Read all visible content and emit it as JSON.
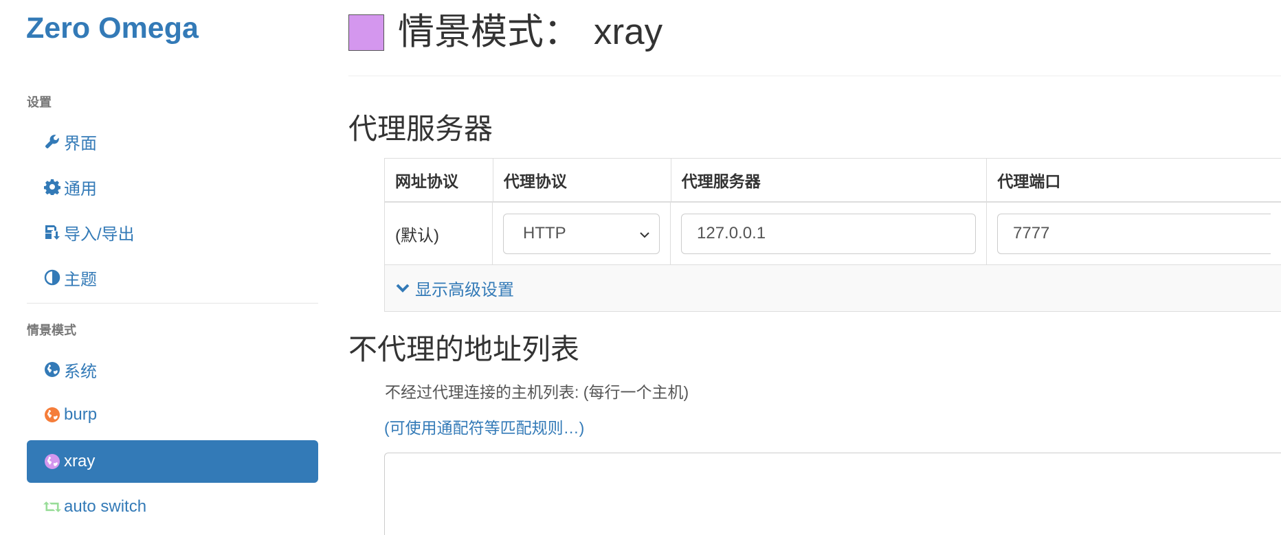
{
  "brand": "Zero Omega",
  "sidebar": {
    "settings_header": "设置",
    "settings_items": [
      {
        "label": "界面",
        "icon": "wrench-icon"
      },
      {
        "label": "通用",
        "icon": "gear-icon"
      },
      {
        "label": "导入/导出",
        "icon": "floppy-import-icon"
      },
      {
        "label": "主题",
        "icon": "contrast-icon"
      }
    ],
    "profiles_header": "情景模式",
    "profile_items": [
      {
        "label": "系统",
        "icon": "globe-icon",
        "color": "#337ab7"
      },
      {
        "label": "burp",
        "icon": "globe-icon",
        "color": "#f57d3a"
      },
      {
        "label": "xray",
        "icon": "globe-icon",
        "color": "#d497ee",
        "active": true
      },
      {
        "label": "auto switch",
        "icon": "switch-icon",
        "color": "#99dd99"
      }
    ]
  },
  "page": {
    "title_prefix": "情景模式：",
    "profile_name": "xray",
    "profile_color": "#d497ee"
  },
  "proxy_section": {
    "title": "代理服务器",
    "headers": [
      "网址协议",
      "代理协议",
      "代理服务器",
      "代理端口"
    ],
    "row": {
      "scheme": "(默认)",
      "protocol": "HTTP",
      "server": "127.0.0.1",
      "port": "7777"
    },
    "advanced_label": "显示高级设置"
  },
  "bypass_section": {
    "title": "不代理的地址列表",
    "description": "不经过代理连接的主机列表: (每行一个主机)",
    "wildcard_link": "(可使用通配符等匹配规则…)",
    "textarea_value": ""
  },
  "colors": {
    "accent": "#337ab7",
    "active_bg": "#337ab7"
  }
}
